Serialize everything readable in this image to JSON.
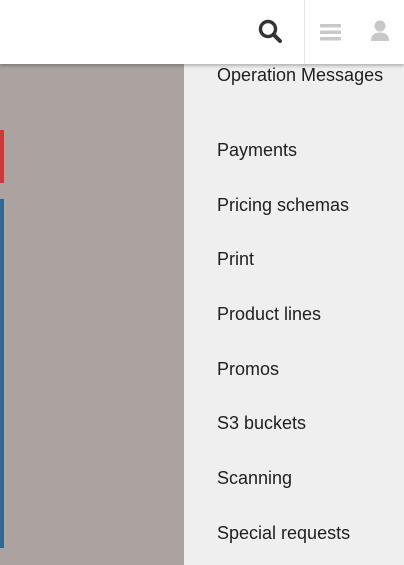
{
  "topbar": {
    "icons": {
      "search": "search-icon",
      "menu": "hamburger-menu-icon",
      "user": "user-icon"
    },
    "colors": {
      "search_icon": "#333333",
      "disabled_icon": "#c8c8c8"
    }
  },
  "drawer": {
    "items": [
      {
        "label": "Operation Messages"
      },
      {
        "label": "Payments"
      },
      {
        "label": "Pricing schemas"
      },
      {
        "label": "Print"
      },
      {
        "label": "Product lines"
      },
      {
        "label": "Promos"
      },
      {
        "label": "S3 buckets"
      },
      {
        "label": "Scanning"
      },
      {
        "label": "Special requests"
      }
    ]
  },
  "colors": {
    "backdrop": "#aba3a0",
    "drawer_bg": "#efefef",
    "accent_red": "#d0373a",
    "accent_blue": "#2e6995"
  }
}
